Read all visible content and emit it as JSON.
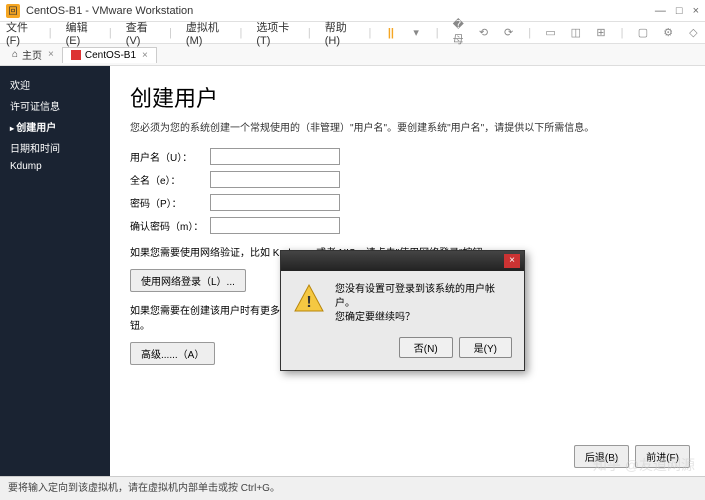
{
  "window": {
    "title": "CentOS-B1 - VMware Workstation",
    "min": "—",
    "max": "□",
    "close": "×"
  },
  "menu": {
    "file": "文件(F)",
    "edit": "编辑(E)",
    "view": "查看(V)",
    "vm": "虚拟机(M)",
    "tabs": "选项卡(T)",
    "help": "帮助(H)"
  },
  "tabs": {
    "home": "主页",
    "vm": "CentOS-B1"
  },
  "sidebar": {
    "items": [
      {
        "label": "欢迎"
      },
      {
        "label": "许可证信息"
      },
      {
        "label": "创建用户"
      },
      {
        "label": "日期和时间"
      },
      {
        "label": "Kdump"
      }
    ],
    "active_index": 2
  },
  "page": {
    "title": "创建用户",
    "desc": "您必须为您的系统创建一个常规使用的（非管理）\"用户名\"。要创建系统\"用户名\"，请提供以下所需信息。",
    "fields": {
      "username_label": "用户名（U）：",
      "fullname_label": "全名（e）：",
      "password_label": "密码（P）：",
      "confirm_label": "确认密码（m）：",
      "username_val": "",
      "fullname_val": "",
      "password_val": "",
      "confirm_val": ""
    },
    "hint1": "如果您需要使用网络验证，比如 Kerberos 或者 NIS，请点击\"使用网络登录\"按钮。",
    "net_login_btn": "使用网络登录（L）...",
    "hint2": "如果您需要在创建该用户时有更多控制 [ 指",
    "hint2_suffix": "钮。",
    "advanced_btn": "高级......（A）",
    "back_btn": "后退(B)",
    "forward_btn": "前进(F)"
  },
  "dialog": {
    "line1": "您没有设置可登录到该系统的用户帐户。",
    "line2": "您确定要继续吗？",
    "no_btn": "否(N)",
    "yes_btn": "是(Y)"
  },
  "statusbar": "要将输入定向到该虚拟机，请在虚拟机内部单击或按 Ctrl+G。",
  "watermark": "知乎 @友道网源"
}
